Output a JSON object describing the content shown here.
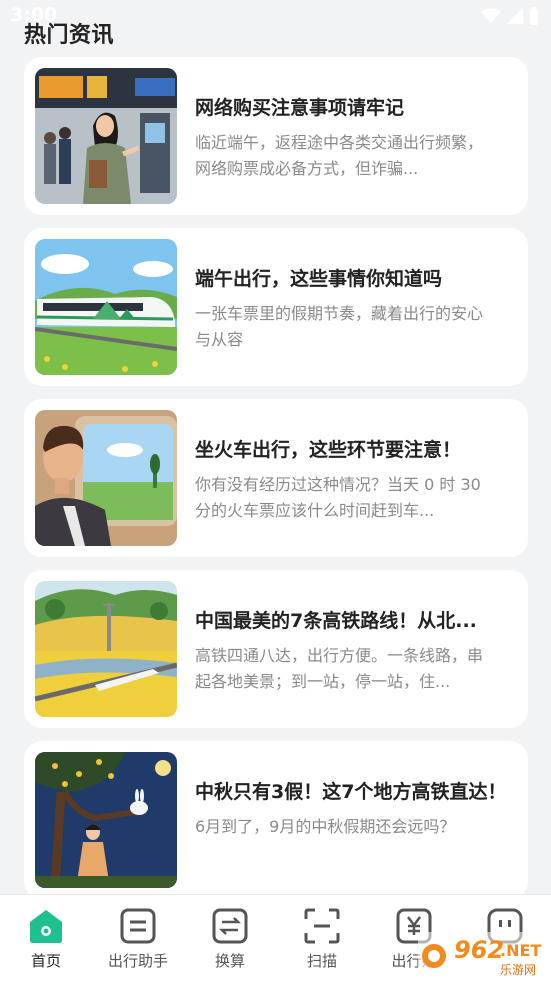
{
  "status_bar": {
    "time": "3:00"
  },
  "page": {
    "title": "热门资讯"
  },
  "news": [
    {
      "title": "网络购买注意事项请牢记",
      "desc": "临近端午，返程途中各类交通出行频繁，网络购票成必备方式，但诈骗..."
    },
    {
      "title": "端午出行，这些事情你知道吗",
      "desc": "一张车票里的假期节奏，藏着出行的安心与从容"
    },
    {
      "title": "坐火车出行，这些环节要注意！",
      "desc": "你有没有经历过这种情况？当天 0 时 30 分的火车票应该什么时间赶到车..."
    },
    {
      "title": "中国最美的7条高铁路线！从北...",
      "desc": "高铁四通八达，出行方便。一条线路，串起各地美景；到一站，停一站，住..."
    },
    {
      "title": "中秋只有3假！这7个地方高铁直达！",
      "desc": "6月到了，9月的中秋假期还会远吗？"
    }
  ],
  "nav": [
    {
      "label": "首页",
      "icon": "home-icon",
      "active": true
    },
    {
      "label": "出行助手",
      "icon": "assistant-icon"
    },
    {
      "label": "换算",
      "icon": "convert-icon"
    },
    {
      "label": "扫描",
      "icon": "scan-icon"
    },
    {
      "label": "出行账",
      "icon": "ledger-icon"
    },
    {
      "label": "",
      "icon": "profile-icon"
    }
  ],
  "watermark": {
    "text": "962.NET",
    "sub": "乐游网"
  },
  "colors": {
    "accent": "#1fbf8f",
    "background": "#f2f3f5",
    "card": "#ffffff"
  }
}
